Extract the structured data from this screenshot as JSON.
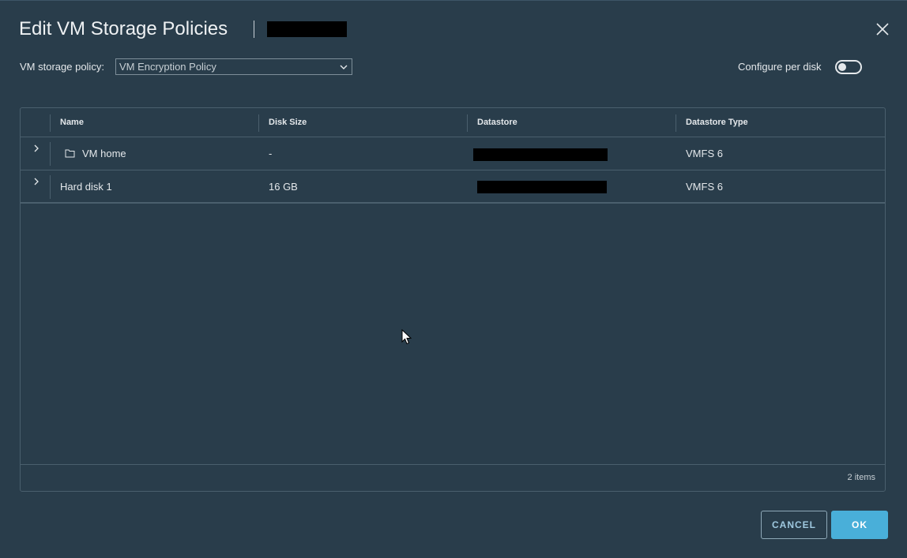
{
  "dialog": {
    "title": "Edit VM Storage Policies"
  },
  "policy": {
    "label": "VM storage policy:",
    "selected": "VM Encryption Policy"
  },
  "per_disk": {
    "label": "Configure per disk",
    "enabled": false
  },
  "grid": {
    "columns": [
      "Name",
      "Disk Size",
      "Datastore",
      "Datastore Type"
    ],
    "rows": [
      {
        "name": "VM home",
        "disk_size": "-",
        "datastore_type": "VMFS 6",
        "icon": "folder-icon"
      },
      {
        "name": "Hard disk 1",
        "disk_size": "16 GB",
        "datastore_type": "VMFS 6"
      }
    ],
    "footer": "2 items"
  },
  "buttons": {
    "cancel": "CANCEL",
    "ok": "OK"
  },
  "colors": {
    "background": "#293d4b",
    "primary": "#49afd9",
    "text": "#e4e8eb"
  }
}
